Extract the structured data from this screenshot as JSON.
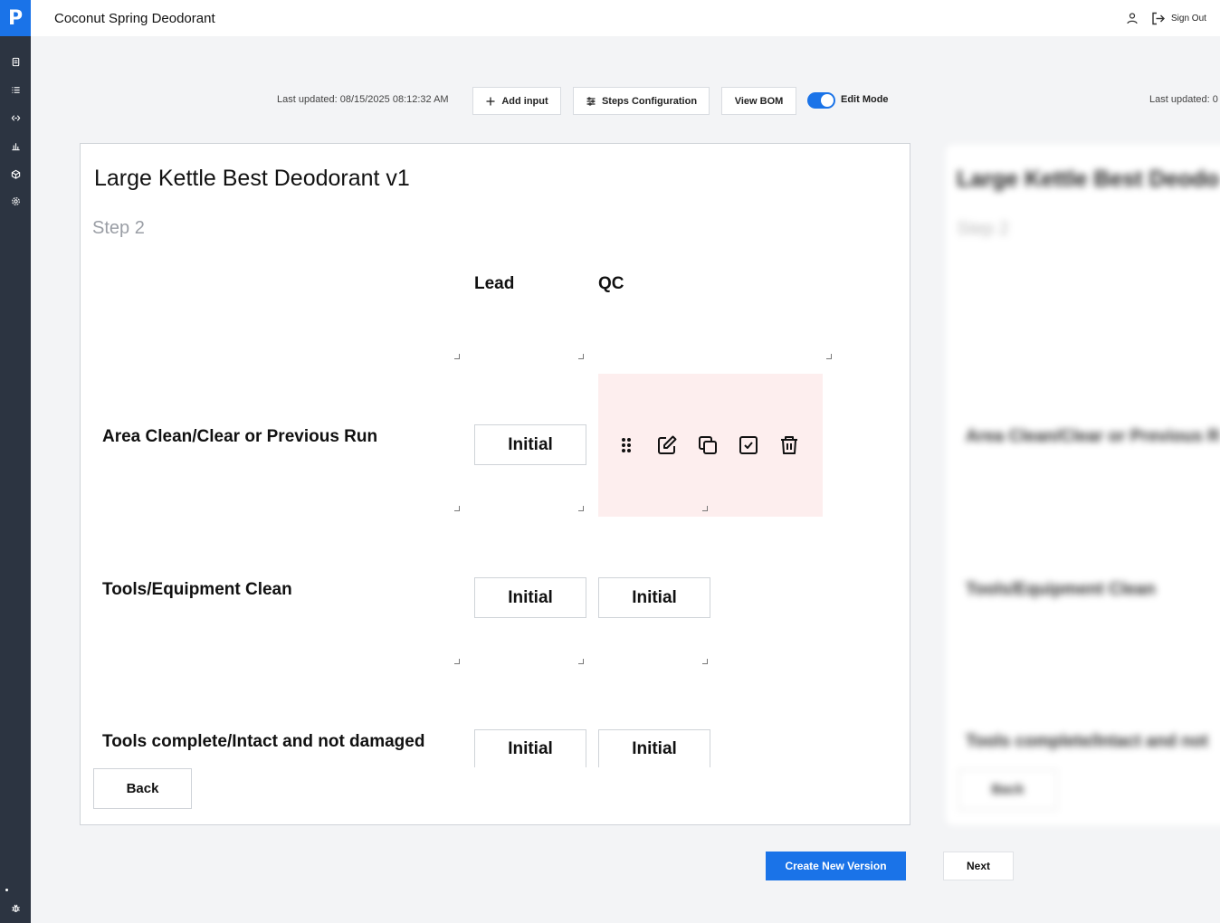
{
  "app": {
    "logo_letter": "P",
    "title": "Coconut Spring Deodorant"
  },
  "header": {
    "sign_out_label": "Sign Out"
  },
  "sidebar": {
    "icons": [
      "clipboard-icon",
      "list-icon",
      "link-icon",
      "chart-icon",
      "box-icon",
      "gear-icon"
    ],
    "bottom_icon": "bug-icon"
  },
  "toolbar": {
    "last_updated": "Last updated: 08/15/2025 08:12:32 AM",
    "add_input_label": "Add input",
    "steps_config_label": "Steps Configuration",
    "view_bom_label": "View BOM",
    "edit_mode_label": "Edit Mode",
    "edit_mode_on": true,
    "last_updated_ghost": "Last updated: 0"
  },
  "form": {
    "title": "Large Kettle Best Deodorant v1",
    "step": "Step 2",
    "columns": [
      "Lead",
      "QC"
    ],
    "rows": [
      {
        "label": "Area Clean/Clear or Previous Run",
        "lead": "Initial",
        "qc": ""
      },
      {
        "label": "Tools/Equipment Clean",
        "lead": "Initial",
        "qc": "Initial"
      },
      {
        "label": "Tools complete/Intact and not damaged",
        "lead": "Initial",
        "qc": "Initial"
      }
    ],
    "cell_actions": [
      "drag-handle-icon",
      "edit-icon",
      "copy-icon",
      "checkbox-icon",
      "trash-icon"
    ],
    "back_label": "Back"
  },
  "ghost": {
    "title": "Large Kettle Best Deodo",
    "step": "Step 2",
    "rows": [
      "Area Clean/Clear or Previous R",
      "Tools/Equipment Clean",
      "Tools complete/Intact and not"
    ],
    "back_label": "Back"
  },
  "footer": {
    "create_version_label": "Create New Version",
    "next_label": "Next"
  },
  "colors": {
    "accent": "#1a73e8",
    "sidebar": "#2c3441",
    "hover_cell": "#fdeeee"
  }
}
